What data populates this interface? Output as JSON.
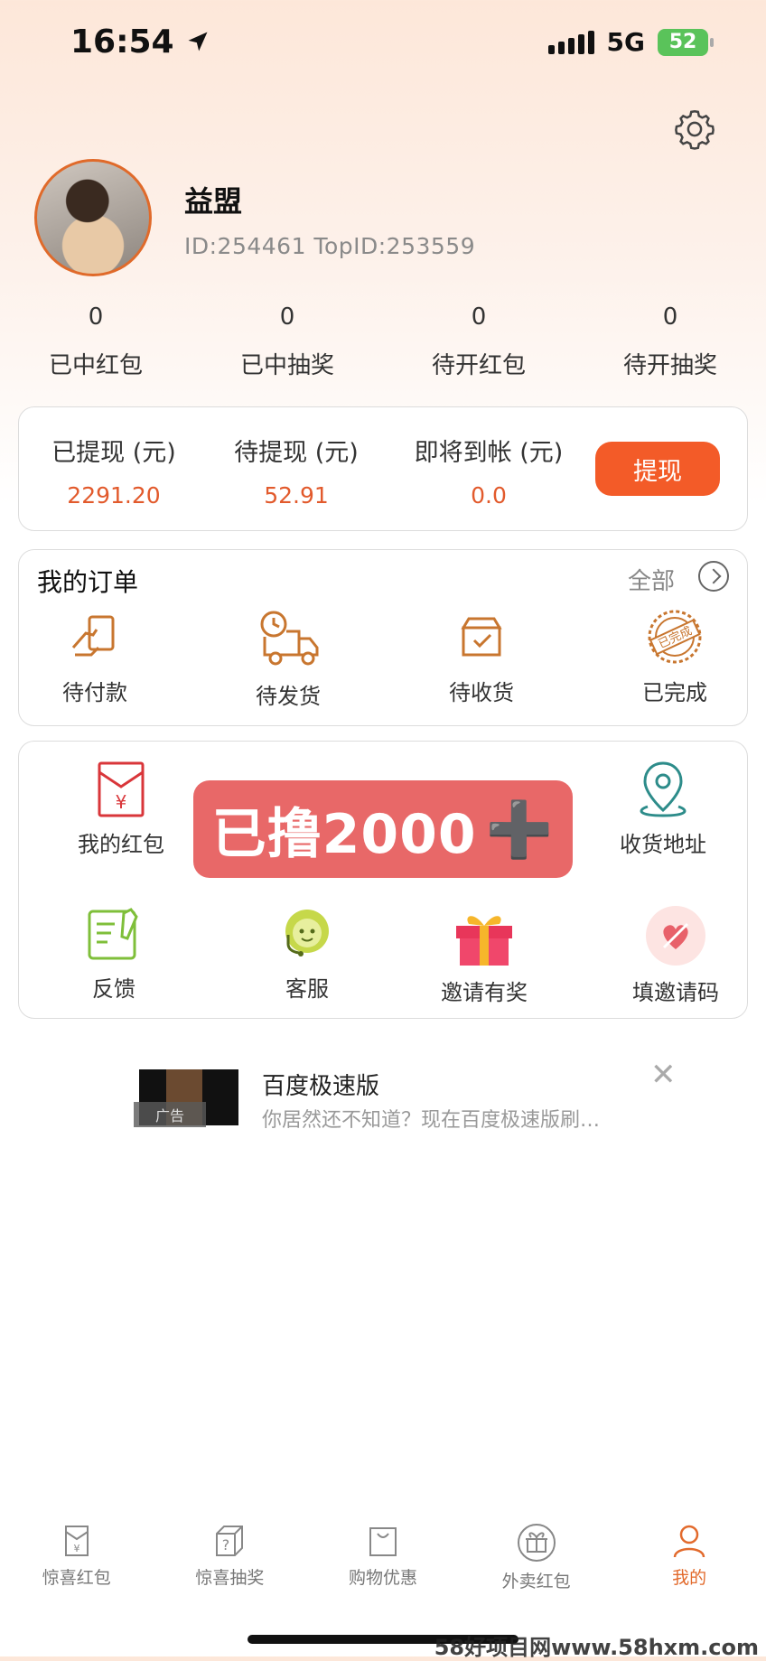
{
  "status_bar": {
    "time": "16:54",
    "network": "5G",
    "battery": "52"
  },
  "profile": {
    "name": "益盟",
    "id_line": "ID:254461   TopID:253559"
  },
  "stats": [
    {
      "value": "0",
      "label": "已中红包"
    },
    {
      "value": "0",
      "label": "已中抽奖"
    },
    {
      "value": "0",
      "label": "待开红包"
    },
    {
      "value": "0",
      "label": "待开抽奖"
    }
  ],
  "withdraw": {
    "items": [
      {
        "label": "已提现 (元)",
        "value": "2291.20"
      },
      {
        "label": "待提现 (元)",
        "value": "52.91"
      },
      {
        "label": "即将到帐 (元)",
        "value": "0.0"
      }
    ],
    "button": "提现"
  },
  "orders": {
    "title": "我的订单",
    "all": "全部",
    "items": [
      {
        "label": "待付款",
        "icon": "payment-icon"
      },
      {
        "label": "待发货",
        "icon": "truck-icon"
      },
      {
        "label": "待收货",
        "icon": "box-icon"
      },
      {
        "label": "已完成",
        "icon": "completed-stamp-icon",
        "stamp_text": "已完成"
      }
    ]
  },
  "services": {
    "items": [
      {
        "label": "我的红包",
        "icon": "red-envelope-icon"
      },
      {
        "label": "收货地址",
        "icon": "location-icon"
      },
      {
        "label": "反馈",
        "icon": "feedback-icon"
      },
      {
        "label": "客服",
        "icon": "customer-service-icon"
      },
      {
        "label": "邀请有奖",
        "icon": "gift-icon"
      },
      {
        "label": "填邀请码",
        "icon": "invite-code-icon"
      }
    ]
  },
  "overlay_banner": {
    "text": "已撸2000",
    "plus": "➕"
  },
  "ad": {
    "title": "百度极速版",
    "description": "你居然还不知道？现在百度极速版刷…",
    "tag": "广告",
    "close": "✕"
  },
  "tabbar": [
    {
      "label": "惊喜红包",
      "icon": "envelope-tab-icon"
    },
    {
      "label": "惊喜抽奖",
      "icon": "lottery-tab-icon"
    },
    {
      "label": "购物优惠",
      "icon": "shopping-bag-icon"
    },
    {
      "label": "外卖红包",
      "icon": "takeout-gift-icon"
    },
    {
      "label": "我的",
      "icon": "user-icon",
      "active": true
    }
  ],
  "watermark": "58好项目网www.58hxm.com",
  "colors": {
    "accent": "#f35b28",
    "value_red": "#e25a2c",
    "icon_brown": "#c8762f",
    "tab_active": "#e26a2c"
  }
}
